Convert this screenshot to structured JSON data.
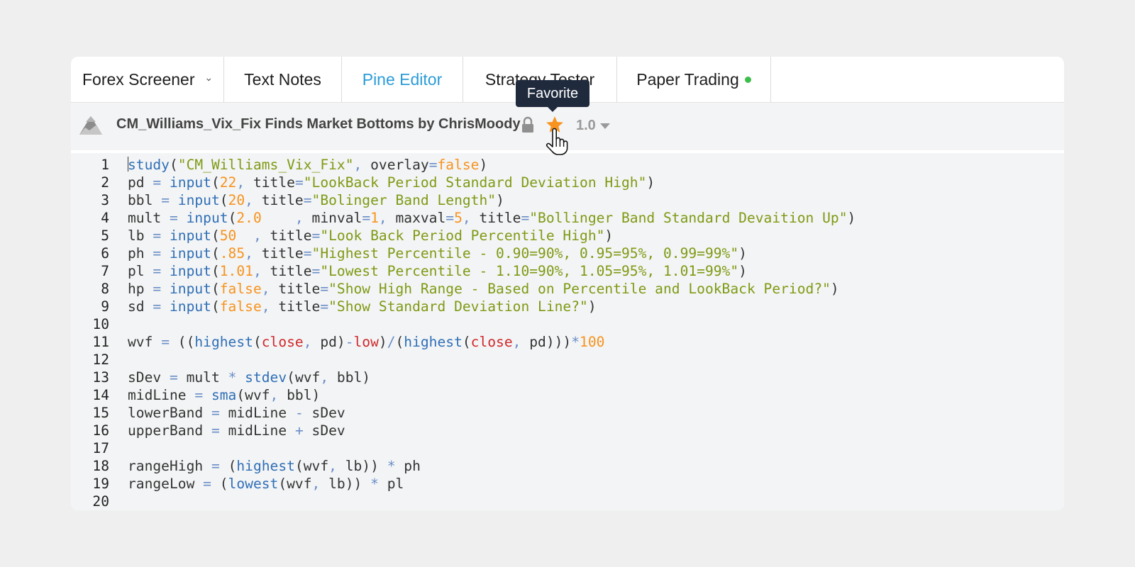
{
  "tabs": {
    "forex": "Forex Screener",
    "text_notes": "Text Notes",
    "pine_editor": "Pine Editor",
    "strategy_tester": "Strategy Tester",
    "paper_trading": "Paper Trading"
  },
  "tooltip": "Favorite",
  "script": {
    "title": "CM_Williams_Vix_Fix Finds Market Bottoms by ChrisMoody",
    "version": "1.0"
  },
  "colors": {
    "accent": "#2b9cd8",
    "star": "#f7931e",
    "status_dot": "#3ebd4c"
  },
  "code_lines": [
    [
      [
        "study",
        "kw"
      ],
      [
        "(",
        "txt"
      ],
      [
        "\"CM_Williams_Vix_Fix\"",
        "str"
      ],
      [
        ", ",
        "op"
      ],
      [
        "overlay",
        "txt"
      ],
      [
        "=",
        "op"
      ],
      [
        "false",
        "num"
      ],
      [
        ")",
        "txt"
      ]
    ],
    [
      [
        "pd ",
        "txt"
      ],
      [
        "= ",
        "op"
      ],
      [
        "input",
        "kw"
      ],
      [
        "(",
        "txt"
      ],
      [
        "22",
        "num"
      ],
      [
        ", ",
        "op"
      ],
      [
        "title",
        "txt"
      ],
      [
        "=",
        "op"
      ],
      [
        "\"LookBack Period Standard Deviation High\"",
        "str"
      ],
      [
        ")",
        "txt"
      ]
    ],
    [
      [
        "bbl ",
        "txt"
      ],
      [
        "= ",
        "op"
      ],
      [
        "input",
        "kw"
      ],
      [
        "(",
        "txt"
      ],
      [
        "20",
        "num"
      ],
      [
        ", ",
        "op"
      ],
      [
        "title",
        "txt"
      ],
      [
        "=",
        "op"
      ],
      [
        "\"Bolinger Band Length\"",
        "str"
      ],
      [
        ")",
        "txt"
      ]
    ],
    [
      [
        "mult ",
        "txt"
      ],
      [
        "= ",
        "op"
      ],
      [
        "input",
        "kw"
      ],
      [
        "(",
        "txt"
      ],
      [
        "2.0",
        "num"
      ],
      [
        "    , ",
        "op"
      ],
      [
        "minval",
        "txt"
      ],
      [
        "=",
        "op"
      ],
      [
        "1",
        "num"
      ],
      [
        ", ",
        "op"
      ],
      [
        "maxval",
        "txt"
      ],
      [
        "=",
        "op"
      ],
      [
        "5",
        "num"
      ],
      [
        ", ",
        "op"
      ],
      [
        "title",
        "txt"
      ],
      [
        "=",
        "op"
      ],
      [
        "\"Bollinger Band Standard Devaition Up\"",
        "str"
      ],
      [
        ")",
        "txt"
      ]
    ],
    [
      [
        "lb ",
        "txt"
      ],
      [
        "= ",
        "op"
      ],
      [
        "input",
        "kw"
      ],
      [
        "(",
        "txt"
      ],
      [
        "50",
        "num"
      ],
      [
        "  , ",
        "op"
      ],
      [
        "title",
        "txt"
      ],
      [
        "=",
        "op"
      ],
      [
        "\"Look Back Period Percentile High\"",
        "str"
      ],
      [
        ")",
        "txt"
      ]
    ],
    [
      [
        "ph ",
        "txt"
      ],
      [
        "= ",
        "op"
      ],
      [
        "input",
        "kw"
      ],
      [
        "(",
        "txt"
      ],
      [
        ".85",
        "num"
      ],
      [
        ", ",
        "op"
      ],
      [
        "title",
        "txt"
      ],
      [
        "=",
        "op"
      ],
      [
        "\"Highest Percentile - 0.90=90%, 0.95=95%, 0.99=99%\"",
        "str"
      ],
      [
        ")",
        "txt"
      ]
    ],
    [
      [
        "pl ",
        "txt"
      ],
      [
        "= ",
        "op"
      ],
      [
        "input",
        "kw"
      ],
      [
        "(",
        "txt"
      ],
      [
        "1.01",
        "num"
      ],
      [
        ", ",
        "op"
      ],
      [
        "title",
        "txt"
      ],
      [
        "=",
        "op"
      ],
      [
        "\"Lowest Percentile - 1.10=90%, 1.05=95%, 1.01=99%\"",
        "str"
      ],
      [
        ")",
        "txt"
      ]
    ],
    [
      [
        "hp ",
        "txt"
      ],
      [
        "= ",
        "op"
      ],
      [
        "input",
        "kw"
      ],
      [
        "(",
        "txt"
      ],
      [
        "false",
        "num"
      ],
      [
        ", ",
        "op"
      ],
      [
        "title",
        "txt"
      ],
      [
        "=",
        "op"
      ],
      [
        "\"Show High Range - Based on Percentile and LookBack Period?\"",
        "str"
      ],
      [
        ")",
        "txt"
      ]
    ],
    [
      [
        "sd ",
        "txt"
      ],
      [
        "= ",
        "op"
      ],
      [
        "input",
        "kw"
      ],
      [
        "(",
        "txt"
      ],
      [
        "false",
        "num"
      ],
      [
        ", ",
        "op"
      ],
      [
        "title",
        "txt"
      ],
      [
        "=",
        "op"
      ],
      [
        "\"Show Standard Deviation Line?\"",
        "str"
      ],
      [
        ")",
        "txt"
      ]
    ],
    [],
    [
      [
        "wvf ",
        "txt"
      ],
      [
        "= ",
        "op"
      ],
      [
        "((",
        "txt"
      ],
      [
        "highest",
        "kw"
      ],
      [
        "(",
        "txt"
      ],
      [
        "close",
        "var"
      ],
      [
        ", ",
        "op"
      ],
      [
        "pd)",
        "txt"
      ],
      [
        "-",
        "op"
      ],
      [
        "low",
        "var"
      ],
      [
        ")",
        "txt"
      ],
      [
        "/",
        "op"
      ],
      [
        "(",
        "txt"
      ],
      [
        "highest",
        "kw"
      ],
      [
        "(",
        "txt"
      ],
      [
        "close",
        "var"
      ],
      [
        ", ",
        "op"
      ],
      [
        "pd)))",
        "txt"
      ],
      [
        "*",
        "op"
      ],
      [
        "100",
        "num"
      ]
    ],
    [],
    [
      [
        "sDev ",
        "txt"
      ],
      [
        "= ",
        "op"
      ],
      [
        "mult ",
        "txt"
      ],
      [
        "* ",
        "op"
      ],
      [
        "stdev",
        "kw"
      ],
      [
        "(",
        "txt"
      ],
      [
        "wvf",
        "txt"
      ],
      [
        ", ",
        "op"
      ],
      [
        "bbl)",
        "txt"
      ]
    ],
    [
      [
        "midLine ",
        "txt"
      ],
      [
        "= ",
        "op"
      ],
      [
        "sma",
        "kw"
      ],
      [
        "(",
        "txt"
      ],
      [
        "wvf",
        "txt"
      ],
      [
        ", ",
        "op"
      ],
      [
        "bbl)",
        "txt"
      ]
    ],
    [
      [
        "lowerBand ",
        "txt"
      ],
      [
        "= ",
        "op"
      ],
      [
        "midLine ",
        "txt"
      ],
      [
        "- ",
        "op"
      ],
      [
        "sDev",
        "txt"
      ]
    ],
    [
      [
        "upperBand ",
        "txt"
      ],
      [
        "= ",
        "op"
      ],
      [
        "midLine ",
        "txt"
      ],
      [
        "+ ",
        "op"
      ],
      [
        "sDev",
        "txt"
      ]
    ],
    [],
    [
      [
        "rangeHigh ",
        "txt"
      ],
      [
        "= ",
        "op"
      ],
      [
        "(",
        "txt"
      ],
      [
        "highest",
        "kw"
      ],
      [
        "(",
        "txt"
      ],
      [
        "wvf",
        "txt"
      ],
      [
        ", ",
        "op"
      ],
      [
        "lb)) ",
        "txt"
      ],
      [
        "* ",
        "op"
      ],
      [
        "ph",
        "txt"
      ]
    ],
    [
      [
        "rangeLow ",
        "txt"
      ],
      [
        "= ",
        "op"
      ],
      [
        "(",
        "txt"
      ],
      [
        "lowest",
        "kw"
      ],
      [
        "(",
        "txt"
      ],
      [
        "wvf",
        "txt"
      ],
      [
        ", ",
        "op"
      ],
      [
        "lb)) ",
        "txt"
      ],
      [
        "* ",
        "op"
      ],
      [
        "pl",
        "txt"
      ]
    ],
    []
  ]
}
